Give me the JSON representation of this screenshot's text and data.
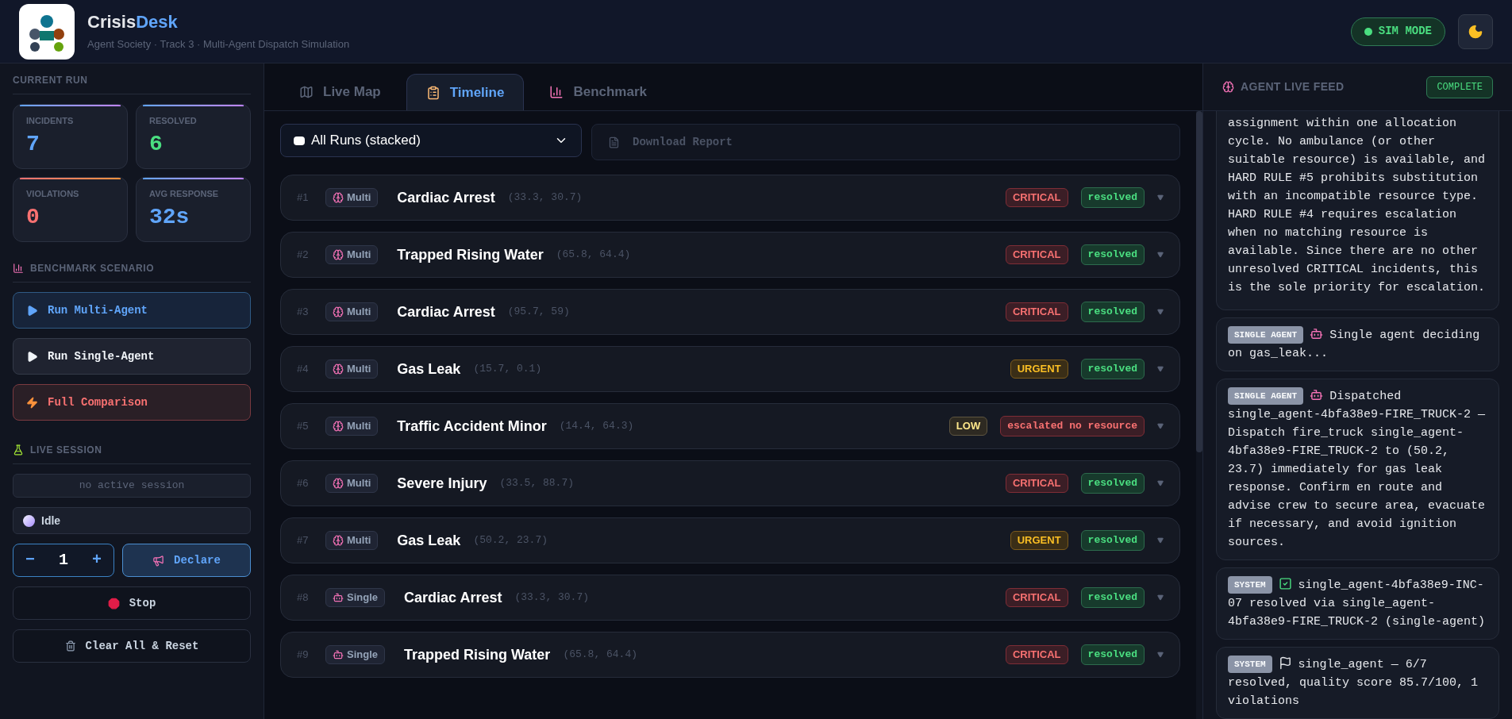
{
  "header": {
    "title": {
      "main": "Crisis",
      "accent": "Desk"
    },
    "subtitle": "Agent Society · Track 3 · Multi-Agent Dispatch Simulation",
    "mode_badge": "SIM MODE"
  },
  "sidebar": {
    "current_run": {
      "heading": "CURRENT RUN",
      "stats": [
        {
          "label": "INCIDENTS",
          "value": "7",
          "kind": "info"
        },
        {
          "label": "RESOLVED",
          "value": "6",
          "kind": "success"
        },
        {
          "label": "VIOLATIONS",
          "value": "0",
          "kind": "danger"
        },
        {
          "label": "AVG RESPONSE",
          "value": "32s",
          "kind": "info"
        }
      ]
    },
    "benchmark": {
      "heading": "BENCHMARK SCENARIO",
      "buttons": [
        {
          "label": "Run Multi-Agent",
          "kind": "primary"
        },
        {
          "label": "Run Single-Agent",
          "kind": "default"
        },
        {
          "label": "Full Comparison",
          "kind": "danger"
        }
      ]
    },
    "live_session": {
      "heading": "LIVE SESSION",
      "session_field": "no active session",
      "status": "Idle",
      "counter": {
        "minus": "−",
        "value": "1",
        "plus": "+"
      },
      "declare": "Declare",
      "stop": "Stop",
      "clear": "Clear All & Reset"
    }
  },
  "main": {
    "tabs": [
      {
        "label": "Live Map",
        "selected": false
      },
      {
        "label": "Timeline",
        "selected": true
      },
      {
        "label": "Benchmark",
        "selected": false
      }
    ],
    "run_select": "All Runs (stacked)",
    "download": {
      "label": "Download Report",
      "disabled": true
    },
    "incidents": [
      {
        "number": "#1",
        "agent": {
          "label": "Multi",
          "kind": "multi"
        },
        "title": "Cardiac Arrest",
        "coords": "(33.3, 30.7)",
        "priority": {
          "label": "CRITICAL",
          "kind": "critical"
        },
        "status": {
          "label": "resolved",
          "kind": "resolved"
        }
      },
      {
        "number": "#2",
        "agent": {
          "label": "Multi",
          "kind": "multi"
        },
        "title": "Trapped Rising Water",
        "coords": "(65.8, 64.4)",
        "priority": {
          "label": "CRITICAL",
          "kind": "critical"
        },
        "status": {
          "label": "resolved",
          "kind": "resolved"
        }
      },
      {
        "number": "#3",
        "agent": {
          "label": "Multi",
          "kind": "multi"
        },
        "title": "Cardiac Arrest",
        "coords": "(95.7, 59)",
        "priority": {
          "label": "CRITICAL",
          "kind": "critical"
        },
        "status": {
          "label": "resolved",
          "kind": "resolved"
        }
      },
      {
        "number": "#4",
        "agent": {
          "label": "Multi",
          "kind": "multi"
        },
        "title": "Gas Leak",
        "coords": "(15.7, 0.1)",
        "priority": {
          "label": "URGENT",
          "kind": "urgent"
        },
        "status": {
          "label": "resolved",
          "kind": "resolved"
        }
      },
      {
        "number": "#5",
        "agent": {
          "label": "Multi",
          "kind": "multi"
        },
        "title": "Traffic Accident Minor",
        "coords": "(14.4, 64.3)",
        "priority": {
          "label": "LOW",
          "kind": "low"
        },
        "status": {
          "label": "escalated no resource",
          "kind": "escalated"
        }
      },
      {
        "number": "#6",
        "agent": {
          "label": "Multi",
          "kind": "multi"
        },
        "title": "Severe Injury",
        "coords": "(33.5, 88.7)",
        "priority": {
          "label": "CRITICAL",
          "kind": "critical"
        },
        "status": {
          "label": "resolved",
          "kind": "resolved"
        }
      },
      {
        "number": "#7",
        "agent": {
          "label": "Multi",
          "kind": "multi"
        },
        "title": "Gas Leak",
        "coords": "(50.2, 23.7)",
        "priority": {
          "label": "URGENT",
          "kind": "urgent"
        },
        "status": {
          "label": "resolved",
          "kind": "resolved"
        }
      },
      {
        "number": "#8",
        "agent": {
          "label": "Single",
          "kind": "single"
        },
        "title": "Cardiac Arrest",
        "coords": "(33.3, 30.7)",
        "priority": {
          "label": "CRITICAL",
          "kind": "critical"
        },
        "status": {
          "label": "resolved",
          "kind": "resolved"
        }
      },
      {
        "number": "#9",
        "agent": {
          "label": "Single",
          "kind": "single"
        },
        "title": "Trapped Rising Water",
        "coords": "(65.8, 64.4)",
        "priority": {
          "label": "CRITICAL",
          "kind": "critical"
        },
        "status": {
          "label": "resolved",
          "kind": "resolved"
        }
      }
    ]
  },
  "feed": {
    "heading": "AGENT LIVE FEED",
    "status": "COMPLETE",
    "items": [
      {
        "kind": "plain",
        "text": "assignment within one allocation cycle. No ambulance (or other suitable resource) is available, and HARD RULE #5 prohibits substitution with an incompatible resource type. HARD RULE #4 requires escalation when no matching resource is available. Since there are no other unresolved CRITICAL incidents, this is the sole priority for escalation."
      },
      {
        "kind": "agent",
        "tag": "SINGLE AGENT",
        "text": "Single agent deciding on gas_leak..."
      },
      {
        "kind": "agent",
        "tag": "SINGLE AGENT",
        "text": "Dispatched single_agent-4bfa38e9-FIRE_TRUCK-2 — Dispatch fire_truck single_agent-4bfa38e9-FIRE_TRUCK-2 to (50.2, 23.7) immediately for gas leak response. Confirm en route and advise crew to secure area, evacuate if necessary, and avoid ignition sources."
      },
      {
        "kind": "resolution",
        "tag": "SYSTEM",
        "text": "single_agent-4bfa38e9-INC-07 resolved via single_agent-4bfa38e9-FIRE_TRUCK-2 (single-agent)"
      },
      {
        "kind": "summary",
        "tag": "SYSTEM",
        "text": "single_agent — 6/7 resolved, quality score 85.7/100, 1 violations"
      }
    ]
  }
}
